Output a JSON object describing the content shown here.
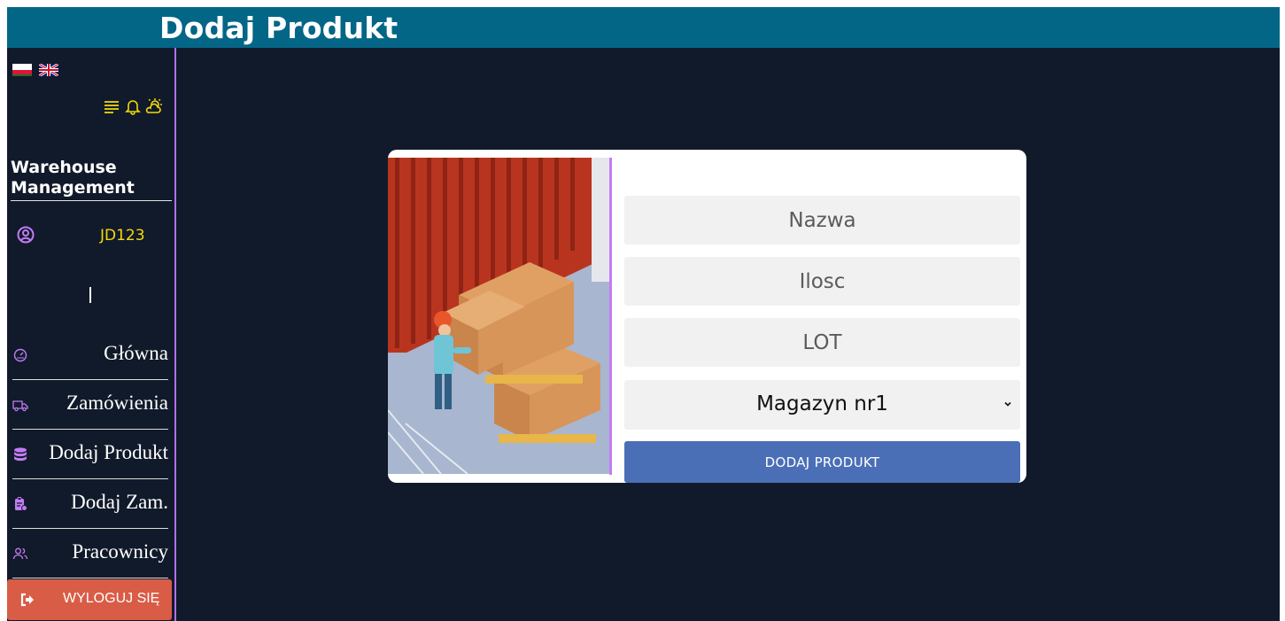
{
  "header": {
    "title": "Dodaj Produkt"
  },
  "sidebar": {
    "languages": [
      "flag-pl",
      "flag-uk"
    ],
    "icons": [
      "menu-icon",
      "bell-icon",
      "weather-icon"
    ],
    "brand": "Warehouse Management",
    "user": {
      "name": "JD123"
    },
    "nav": [
      {
        "label": "Główna",
        "icon": "dashboard-icon"
      },
      {
        "label": "Zamówienia",
        "icon": "truck-icon"
      },
      {
        "label": "Dodaj Produkt",
        "icon": "database-icon"
      },
      {
        "label": "Dodaj Zam.",
        "icon": "clipboard-icon"
      },
      {
        "label": "Pracownicy",
        "icon": "users-icon"
      }
    ],
    "logout_label": "WYLOGUJ SIĘ"
  },
  "form": {
    "name_placeholder": "Nazwa",
    "qty_placeholder": "Ilosc",
    "lot_placeholder": "LOT",
    "warehouse_value": "Magazyn nr1",
    "submit_label": "DODAJ PRODUKT"
  },
  "colors": {
    "header_bg": "#046687",
    "page_bg": "#111a2a",
    "accent_purple": "#b46ff0",
    "user_yellow": "#f5d90a",
    "logout_bg": "#d95c47",
    "submit_bg": "#4a6fb6"
  }
}
